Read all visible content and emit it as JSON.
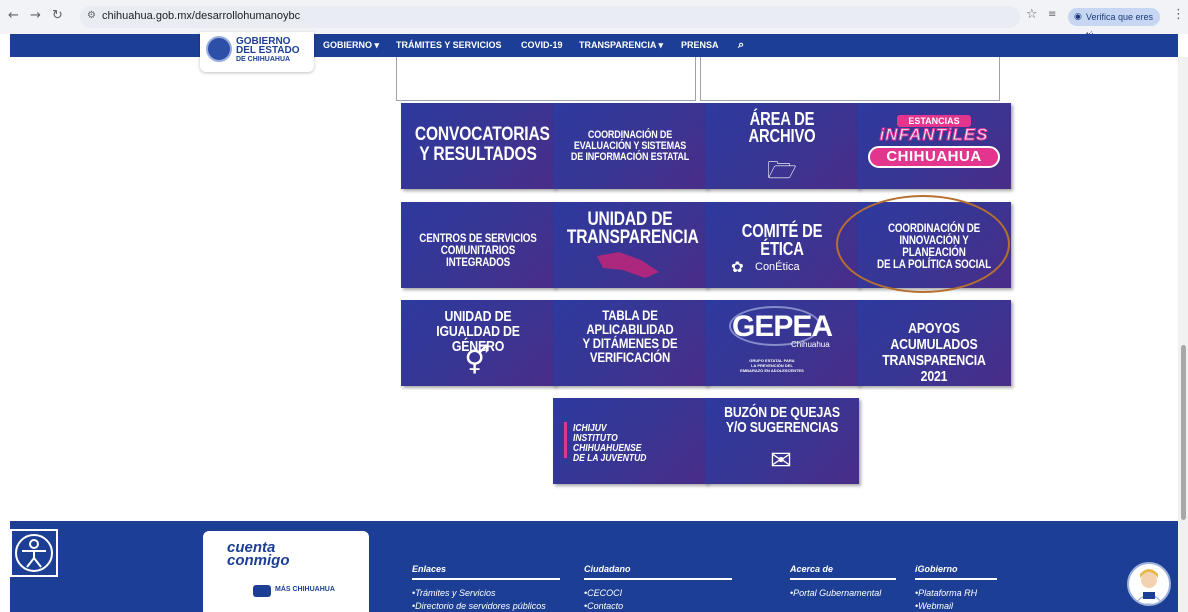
{
  "browser": {
    "url": "chihuahua.gob.mx/desarrollohumanoybc",
    "verify_label": "Verifica que eres tú",
    "icons": [
      "back-icon",
      "forward-icon",
      "reload-icon",
      "site-info-icon",
      "star-icon",
      "extension-icon",
      "menu-icon"
    ]
  },
  "header": {
    "logo_line1": "GOBIERNO",
    "logo_line2": "DEL ESTADO",
    "logo_line3": "DE CHIHUAHUA",
    "nav": [
      "GOBIERNO ▾",
      "TRÁMITES Y SERVICIOS",
      "COVID-19",
      "TRANSPARENCIA ▾",
      "PRENSA"
    ],
    "search_icon": "search-icon"
  },
  "tiles": [
    {
      "label": "CONVOCATORIAS\nY RESULTADOS"
    },
    {
      "label": "COORDINACIÓN DE\nEVALUACIÓN Y SISTEMAS\nDE INFORMACIÓN ESTATAL"
    },
    {
      "label": "ÁREA DE\nARCHIVO"
    },
    {
      "top": "ESTANCIAS",
      "mid": "iNFANTiLES",
      "bottom": "CHIHUAHUA"
    },
    {
      "label": "CENTROS DE SERVICIOS\nCOMUNITARIOS INTEGRADOS"
    },
    {
      "label": "UNIDAD DE\nTRANSPARENCIA"
    },
    {
      "label": "COMITÉ DE ÉTICA",
      "sub": "ConÉtica"
    },
    {
      "label": "COORDINACIÓN DE\nINNOVACIÓN Y PLANEACIÓN\nDE LA POLÍTICA SOCIAL"
    },
    {
      "label": "UNIDAD DE\nIGUALDAD DE GÉNERO"
    },
    {
      "label": "TABLA DE APLICABILIDAD\nY DITÁMENES DE\nVERIFICACIÓN"
    },
    {
      "label": "GEPEA",
      "sub": "Chihuahua",
      "small": "GRUPO ESTATAL PARA\nLA PREVENCIÓN DEL\nEMBARAZO EN ADOLESCENTES"
    },
    {
      "label": "APOYOS ACUMULADOS\nTRANSPARENCIA\n2021"
    },
    {
      "label": "ICHIJUV\nINSTITUTO CHIHUAHUENSE\nDE LA JUVENTUD"
    },
    {
      "label": "BUZÓN DE QUEJAS\nY/O SUGERENCIAS"
    }
  ],
  "footer": {
    "logo_text": "cuenta conmigo",
    "logo_sub": "MÁS CHIHUAHUA",
    "columns": [
      {
        "title": "Enlaces",
        "links": [
          "•Trámites y Servicios",
          "•Directorio de servidores públicos"
        ]
      },
      {
        "title": "Ciudadano",
        "links": [
          "•CECOCI",
          "•Contacto"
        ]
      },
      {
        "title": "Acerca de",
        "links": [
          "•Portal Gubernamental"
        ]
      },
      {
        "title": "iGobierno",
        "links": [
          "•Plataforma RH",
          "•Webmail"
        ]
      }
    ]
  }
}
